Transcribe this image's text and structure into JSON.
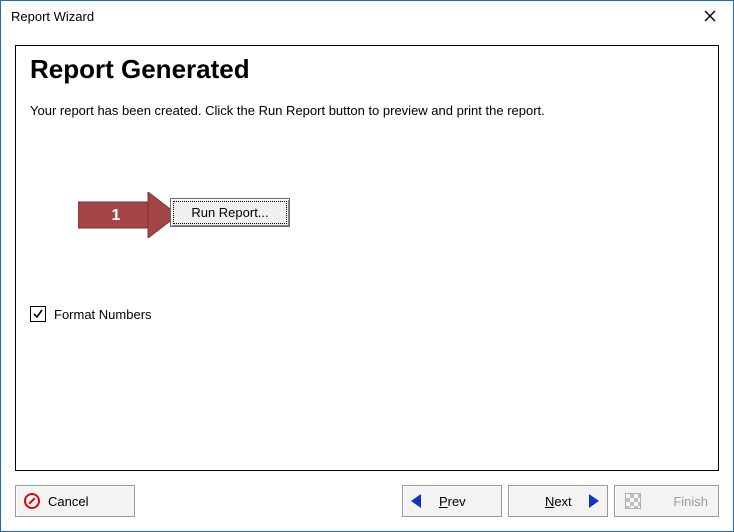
{
  "window": {
    "title": "Report Wizard"
  },
  "page": {
    "heading": "Report Generated",
    "description": "Your report has been created.  Click the Run Report button to preview and print the report."
  },
  "runReport": {
    "label": "Run Report..."
  },
  "arrow": {
    "step": "1",
    "color": "#a34545"
  },
  "checkbox": {
    "label": "Format Numbers",
    "checked": true
  },
  "footer": {
    "cancel": {
      "label": "Cancel"
    },
    "prev": {
      "label_pre": "",
      "label_u": "P",
      "label_post": "rev"
    },
    "next": {
      "label_pre": "",
      "label_u": "N",
      "label_post": "ext"
    },
    "finish": {
      "label": "Finish",
      "enabled": false
    }
  },
  "colors": {
    "navArrow": "#1531c6"
  }
}
